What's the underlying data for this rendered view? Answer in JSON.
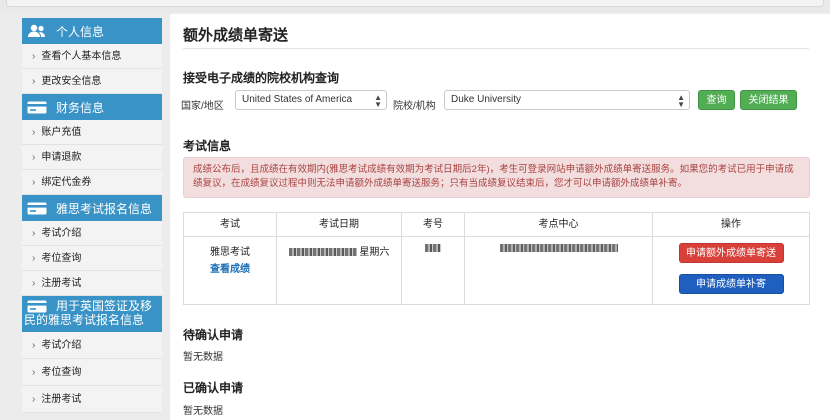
{
  "sidebar": {
    "sections": [
      {
        "title": "个人信息",
        "icon": "users-icon",
        "items": [
          "查看个人基本信息",
          "更改安全信息"
        ]
      },
      {
        "title": "财务信息",
        "icon": "card-icon",
        "items": [
          "账户充值",
          "申请退款",
          "绑定代金券"
        ]
      },
      {
        "title": "雅思考试报名信息",
        "icon": "card-icon",
        "items": [
          "考试介绍",
          "考位查询",
          "注册考试"
        ]
      },
      {
        "title_line1": "用于英国签证及移",
        "title_line2": "民的雅思考试报名信息",
        "icon": "card-icon",
        "items": [
          "考试介绍",
          "考位查询",
          "注册考试"
        ]
      }
    ]
  },
  "main": {
    "title": "额外成绩单寄送",
    "query": {
      "heading": "接受电子成绩的院校机构查询",
      "country_label": "国家/地区",
      "country_value": "United States of America",
      "institution_label": "院校/机构",
      "institution_value": "Duke University",
      "search_button": "查询",
      "close_button": "关闭结果"
    },
    "exam_info": {
      "heading": "考试信息",
      "alert": "成绩公布后，且成绩在有效期内(雅思考试成绩有效期为考试日期后2年)，考生可登录网站申请额外成绩单寄送服务。如果您的考试已用于申请成绩复议，在成绩复议过程中则无法申请额外成绩单寄送服务；只有当成绩复议结束后，您才可以申请额外成绩单补寄。",
      "columns": [
        "考试",
        "考试日期",
        "考号",
        "考点中心",
        "操作"
      ],
      "row": {
        "exam": "雅思考试",
        "view_score": "查看成绩",
        "weekday": "星期六",
        "apply_extra_button": "申请额外成绩单寄送",
        "apply_resend_button": "申请成绩单补寄"
      }
    },
    "pending": {
      "heading": "待确认申请",
      "empty": "暂无数据"
    },
    "confirmed": {
      "heading": "已确认申请",
      "empty": "暂无数据"
    }
  },
  "colors": {
    "sidebar_header": "#3a93c6",
    "button_green": "#52ad55",
    "button_red": "#d9403a",
    "button_blue": "#1f5fbf",
    "alert_bg": "#f2dede",
    "alert_text": "#a94442"
  }
}
